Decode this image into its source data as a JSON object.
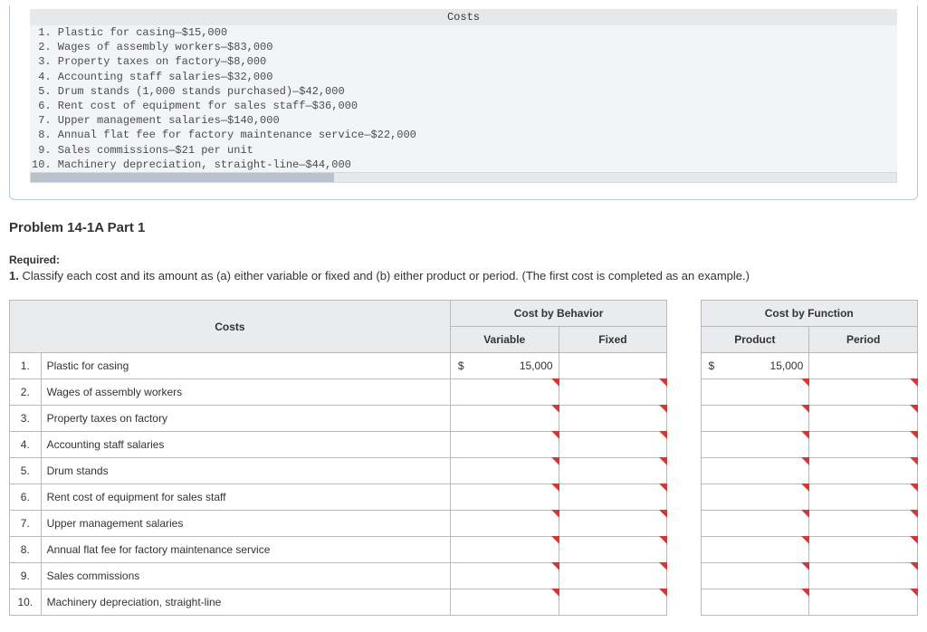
{
  "costs_header": "Costs",
  "costs_list": " 1. Plastic for casing—$15,000\n 2. Wages of assembly workers—$83,000\n 3. Property taxes on factory—$8,000\n 4. Accounting staff salaries—$32,000\n 5. Drum stands (1,000 stands purchased)—$42,000\n 6. Rent cost of equipment for sales staff—$36,000\n 7. Upper management salaries—$140,000\n 8. Annual flat fee for factory maintenance service—$22,000\n 9. Sales commissions—$21 per unit\n10. Machinery depreciation, straight-line—$44,000",
  "problem_title": "Problem 14-1A Part 1",
  "required_label": "Required:",
  "requirement_num": "1.",
  "requirement_text": "Classify each cost and its amount as (a) either variable or fixed and (b) either product or period. (The first cost is completed as an example.)",
  "headers": {
    "costs": "Costs",
    "behavior": "Cost by Behavior",
    "function": "Cost by Function",
    "variable": "Variable",
    "fixed": "Fixed",
    "product": "Product",
    "period": "Period"
  },
  "rows": [
    {
      "n": "1.",
      "name": "Plastic for casing",
      "variable_sym": "$",
      "variable_val": "15,000",
      "product_sym": "$",
      "product_val": "15,000"
    },
    {
      "n": "2.",
      "name": "Wages of assembly workers"
    },
    {
      "n": "3.",
      "name": "Property taxes on factory"
    },
    {
      "n": "4.",
      "name": "Accounting staff salaries"
    },
    {
      "n": "5.",
      "name": "Drum stands"
    },
    {
      "n": "6.",
      "name": "Rent cost of equipment for sales staff"
    },
    {
      "n": "7.",
      "name": "Upper management salaries"
    },
    {
      "n": "8.",
      "name": "Annual flat fee for factory maintenance service"
    },
    {
      "n": "9.",
      "name": "Sales commissions"
    },
    {
      "n": "10.",
      "name": "Machinery depreciation, straight-line"
    }
  ]
}
